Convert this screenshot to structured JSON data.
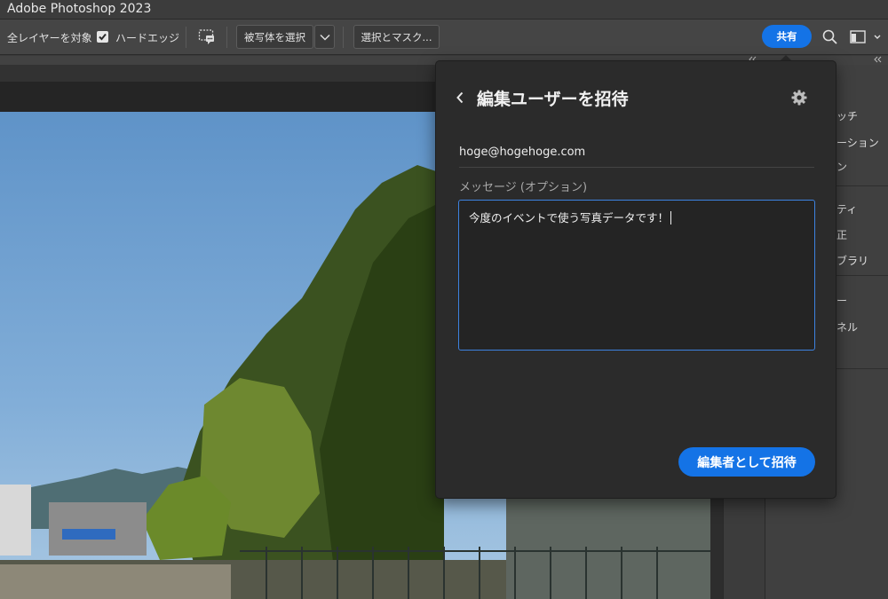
{
  "window": {
    "title": "Adobe Photoshop 2023"
  },
  "options_bar": {
    "sample_all_layers": "全レイヤーを対象",
    "hard_edge": "ハードエッジ",
    "select_subject": "被写体を選択",
    "select_and_mask": "選択とマスク...",
    "share": "共有"
  },
  "right_panel": {
    "items": [
      "ッチ",
      "ーション",
      "ン",
      "ティ",
      "正",
      "ブラリ",
      "ー",
      "ネル"
    ]
  },
  "invite_popover": {
    "title": "編集ユーザーを招待",
    "email": "hoge@hogehoge.com",
    "message_label": "メッセージ (オプション)",
    "message_value": "今度のイベントで使う写真データです！",
    "invite_button": "編集者として招待"
  },
  "colors": {
    "accent": "#1473e6",
    "focus_border": "#3d82e0",
    "popover_bg": "#2b2b2b",
    "toolbar_bg": "#454545"
  },
  "icons": [
    "checkbox-checked-icon",
    "speech-bubble-icon",
    "chevron-down-icon",
    "search-icon",
    "workspace-icon",
    "back-chevron-icon",
    "gear-icon"
  ]
}
